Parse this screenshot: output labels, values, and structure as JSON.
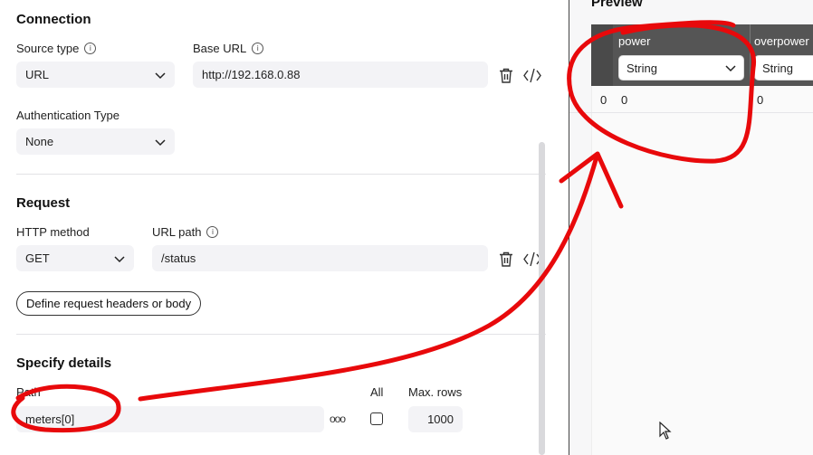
{
  "connection": {
    "title": "Connection",
    "source_type_label": "Source type",
    "source_type_value": "URL",
    "base_url_label": "Base URL",
    "base_url_value": "http://192.168.0.88",
    "auth_label": "Authentication Type",
    "auth_value": "None"
  },
  "request": {
    "title": "Request",
    "method_label": "HTTP method",
    "method_value": "GET",
    "url_path_label": "URL path",
    "url_path_value": "/status",
    "headers_button": "Define request headers or body"
  },
  "details": {
    "title": "Specify details",
    "path_label": "Path",
    "path_value": "meters[0]",
    "all_label": "All",
    "max_rows_label": "Max. rows",
    "max_rows_value": "1000",
    "more_icon": "ooo"
  },
  "preview": {
    "title": "Preview",
    "columns": [
      {
        "name": "power",
        "type": "String"
      },
      {
        "name": "overpower",
        "type": "String"
      }
    ],
    "rows": [
      {
        "index": "0",
        "cells": [
          "0",
          "0"
        ]
      }
    ]
  },
  "annotation_color": "#e8090b"
}
